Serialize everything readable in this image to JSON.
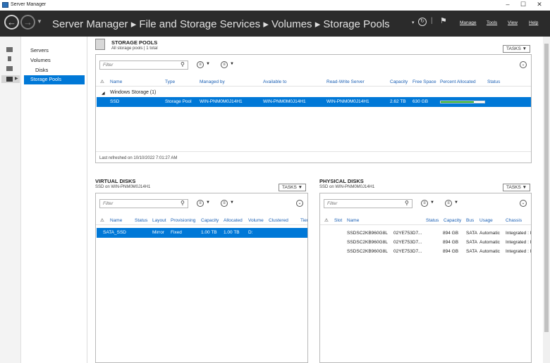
{
  "window": {
    "title": "Server Manager"
  },
  "header": {
    "breadcrumb": "Server Manager  ▸  File and Storage Services  ▸  Volumes  ▸  Storage Pools",
    "menu": {
      "manage": "Manage",
      "tools": "Tools",
      "view": "View",
      "help": "Help"
    }
  },
  "nav": {
    "items": [
      {
        "label": "Servers"
      },
      {
        "label": "Volumes"
      },
      {
        "label": "Disks"
      },
      {
        "label": "Storage Pools"
      }
    ]
  },
  "pools": {
    "title": "STORAGE POOLS",
    "subtitle": "All storage pools | 1 total",
    "tasks": "TASKS",
    "filter_placeholder": "Filter",
    "columns": [
      "Name",
      "Type",
      "Managed by",
      "Available to",
      "Read-Write Server",
      "Capacity",
      "Free Space",
      "Percent Allocated",
      "Status"
    ],
    "group": "Windows Storage (1)",
    "row": {
      "name": "SSD",
      "type": "Storage Pool",
      "managed_by": "WIN-PNM0M0J14H1",
      "available_to": "WIN-PNM0M0J14H1",
      "rw_server": "WIN-PNM0M0J14H1",
      "capacity": "2.62 TB",
      "free_space": "630 GB",
      "percent_allocated": 0.76
    },
    "footer": "Last refreshed on 10/10/2022 7:01:27 AM"
  },
  "virtual_disks": {
    "title": "VIRTUAL DISKS",
    "subtitle": "SSD on WIN-PNM0M0J14H1",
    "tasks": "TASKS",
    "filter_placeholder": "Filter",
    "columns": [
      "Name",
      "Status",
      "Layout",
      "Provisioning",
      "Capacity",
      "Allocated",
      "Volume",
      "Clustered",
      "Tier"
    ],
    "row": {
      "name": "SATA_SSD",
      "status": "",
      "layout": "Mirror",
      "provisioning": "Fixed",
      "capacity": "1.00 TB",
      "allocated": "1.00 TB",
      "volume": "D:"
    }
  },
  "physical_disks": {
    "title": "PHYSICAL DISKS",
    "subtitle": "SSD on WIN-PNM0M0J14H1",
    "tasks": "TASKS",
    "filter_placeholder": "Filter",
    "columns": [
      "Slot",
      "Name",
      "Status",
      "Capacity",
      "Bus",
      "Usage",
      "Chassis"
    ],
    "rows": [
      {
        "name": "SSDSC2KB960G8L",
        "id": "02YE753D7...",
        "capacity": "894 GB",
        "bus": "SATA",
        "usage": "Automatic",
        "chassis": "Integrated : I"
      },
      {
        "name": "SSDSC2KB960G8L",
        "id": "02YE753D7...",
        "capacity": "894 GB",
        "bus": "SATA",
        "usage": "Automatic",
        "chassis": "Integrated : I"
      },
      {
        "name": "SSDSC2KB960G8L",
        "id": "02YE753D7...",
        "capacity": "894 GB",
        "bus": "SATA",
        "usage": "Automatic",
        "chassis": "Integrated : I"
      }
    ]
  },
  "colors": {
    "accent": "#0078d7",
    "header_bg": "#2b2b2b",
    "allocated_fill": "#26b02a"
  }
}
